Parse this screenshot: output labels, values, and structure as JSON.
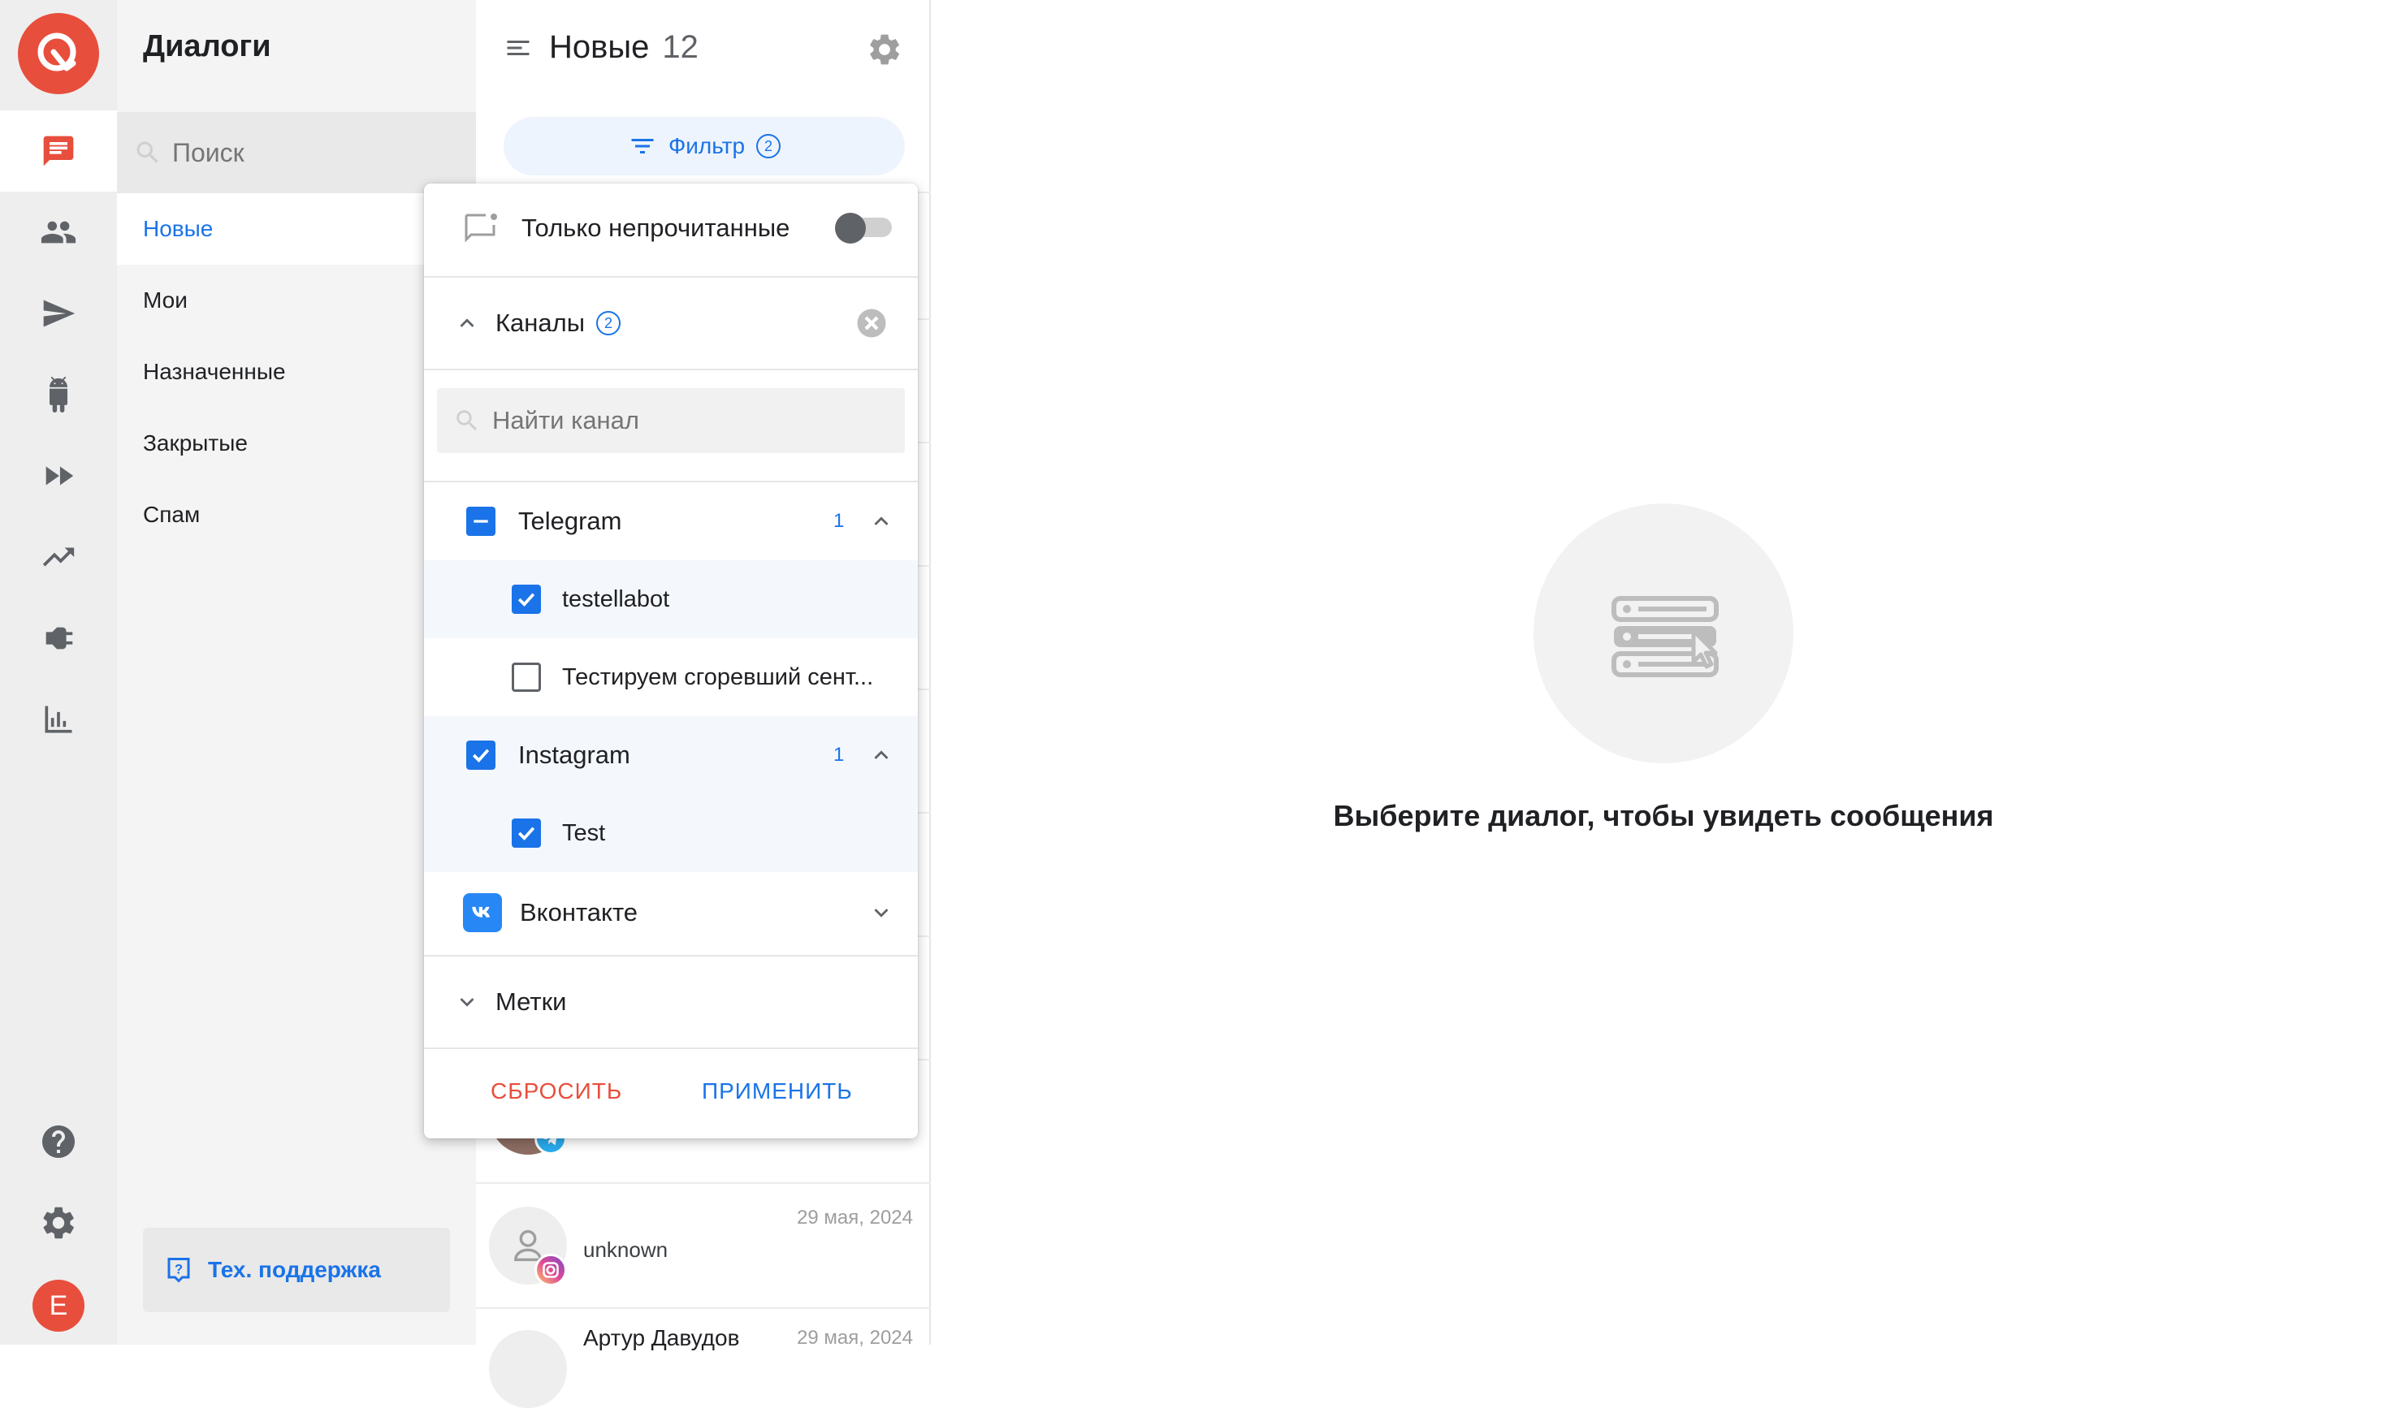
{
  "app": {
    "user_initial": "E"
  },
  "rail": {
    "items": [
      "dialogs-icon",
      "contacts-icon",
      "send-icon",
      "bot-icon",
      "forward-icon",
      "trending-icon",
      "plug-icon",
      "analytics-icon"
    ],
    "bottom": [
      "help-icon",
      "settings-icon"
    ],
    "accent": "#e84e3c"
  },
  "sidebar": {
    "title": "Диалоги",
    "search_placeholder": "Поиск",
    "nav": [
      {
        "label": "Новые",
        "active": true
      },
      {
        "label": "Мои"
      },
      {
        "label": "Назначенные"
      },
      {
        "label": "Закрытые"
      },
      {
        "label": "Спам"
      }
    ],
    "support_label": "Тех. поддержка"
  },
  "list": {
    "title": "Новые",
    "count": "12",
    "filter_label": "Фильтр",
    "filter_count": "2",
    "rows": [
      {
        "name": "unknown",
        "date": "29 мая, 2024",
        "channel": "instagram"
      },
      {
        "name": "Артур Давудов",
        "date": "29 мая, 2024",
        "channel": "telegram"
      }
    ]
  },
  "filter_popup": {
    "unread_only_label": "Только непрочитанные",
    "unread_only": false,
    "channels_label": "Каналы",
    "channels_count": "2",
    "channel_search_placeholder": "Найти канал",
    "groups": [
      {
        "name": "Telegram",
        "count": "1",
        "state": "indeterminate",
        "expanded": true,
        "items": [
          {
            "name": "testellabot",
            "checked": true
          },
          {
            "name": "Тестируем сгоревший сент...",
            "checked": false
          }
        ]
      },
      {
        "name": "Instagram",
        "count": "1",
        "state": "checked",
        "expanded": true,
        "items": [
          {
            "name": "Test",
            "checked": true
          }
        ]
      },
      {
        "name": "Вконтакте",
        "state": "vk",
        "expanded": false
      }
    ],
    "tags_label": "Метки",
    "reset_label": "СБРОСИТЬ",
    "apply_label": "ПРИМЕНИТЬ"
  },
  "empty_state": {
    "text": "Выберите диалог, чтобы увидеть сообщения"
  },
  "colors": {
    "primary": "#1a73e8",
    "danger": "#e84e3c"
  }
}
